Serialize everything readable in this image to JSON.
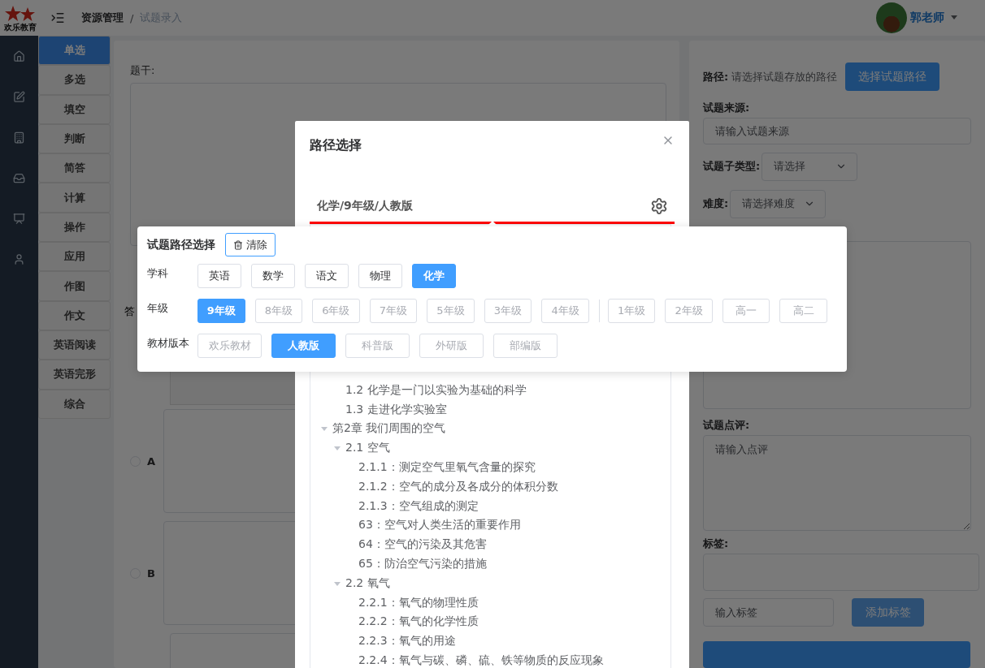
{
  "header": {
    "logo_text": "欢乐教育",
    "breadcrumb_separator": "/",
    "breadcrumb": [
      {
        "label": "资源管理",
        "current": false
      },
      {
        "label": "试题录入",
        "current": true
      }
    ],
    "user": "郭老师"
  },
  "question_types": [
    {
      "label": "单选",
      "selected": true
    },
    {
      "label": "多选",
      "selected": false
    },
    {
      "label": "填空",
      "selected": false
    },
    {
      "label": "判断",
      "selected": false
    },
    {
      "label": "简答",
      "selected": false
    },
    {
      "label": "计算",
      "selected": false
    },
    {
      "label": "操作",
      "selected": false
    },
    {
      "label": "应用",
      "selected": false
    },
    {
      "label": "作图",
      "selected": false
    },
    {
      "label": "作文",
      "selected": false
    },
    {
      "label": "英语阅读",
      "selected": false
    },
    {
      "label": "英语完形",
      "selected": false
    },
    {
      "label": "综合",
      "selected": false
    }
  ],
  "editor": {
    "stem_label": "题干:",
    "answer_label": "答",
    "options": [
      {
        "letter": "A",
        "selected": false
      },
      {
        "letter": "B",
        "selected": false
      }
    ]
  },
  "side_form": {
    "path_label": "路径:",
    "path_hint": "请选择试题存放的路径",
    "path_button": "选择试题路径",
    "source_label": "试题来源:",
    "source_placeholder": "请输入试题来源",
    "subtype_label": "试题子类型:",
    "subtype_placeholder": "请选择",
    "difficulty_label": "难度:",
    "difficulty_placeholder": "请选择难度",
    "comment_label": "试题点评:",
    "comment_placeholder": "请输入点评",
    "tags_label": "标签:",
    "tag_placeholder": "输入标签",
    "add_tag_button": "添加标签"
  },
  "dialog": {
    "title": "路径选择",
    "path": "化学/9年级/人教版",
    "tree": [
      {
        "children": [
          {
            "label": "1.2 化学是一门以实验为基础的科学"
          },
          {
            "label": "1.3 走进化学实验室"
          }
        ]
      },
      {
        "label": "第2章 我们周围的空气",
        "expanded": true,
        "children": [
          {
            "label": "2.1 空气",
            "expanded": true,
            "children": [
              {
                "label": "2.1.1：测定空气里氧气含量的探究"
              },
              {
                "label": "2.1.2：空气的成分及各成分的体积分数"
              },
              {
                "label": "2.1.3：空气组成的测定"
              },
              {
                "label": "63：空气对人类生活的重要作用"
              },
              {
                "label": "64：空气的污染及其危害"
              },
              {
                "label": "65：防治空气污染的措施"
              }
            ]
          },
          {
            "label": "2.2 氧气",
            "expanded": true,
            "children": [
              {
                "label": "2.2.1：氧气的物理性质"
              },
              {
                "label": "2.2.2：氧气的化学性质"
              },
              {
                "label": "2.2.3：氧气的用途"
              },
              {
                "label": "2.2.4：氧气与碳、磷、硫、铁等物质的反应现象"
              }
            ]
          }
        ]
      }
    ]
  },
  "popover": {
    "title": "试题路径选择",
    "clear_button": "清除",
    "rows": [
      {
        "label": "学科",
        "kind": "subject",
        "groups": [
          [
            {
              "label": "英语",
              "selected": false,
              "disabled": false
            },
            {
              "label": "数学",
              "selected": false,
              "disabled": false
            },
            {
              "label": "语文",
              "selected": false,
              "disabled": false
            },
            {
              "label": "物理",
              "selected": false,
              "disabled": false
            },
            {
              "label": "化学",
              "selected": true,
              "disabled": false
            }
          ]
        ]
      },
      {
        "label": "年级",
        "kind": "grade",
        "groups": [
          [
            {
              "label": "9年级",
              "selected": true,
              "disabled": false
            },
            {
              "label": "8年级",
              "selected": false,
              "disabled": true
            },
            {
              "label": "6年级",
              "selected": false,
              "disabled": true
            },
            {
              "label": "7年级",
              "selected": false,
              "disabled": true
            },
            {
              "label": "5年级",
              "selected": false,
              "disabled": true
            },
            {
              "label": "3年级",
              "selected": false,
              "disabled": true
            },
            {
              "label": "4年级",
              "selected": false,
              "disabled": true
            }
          ],
          [
            {
              "label": "1年级",
              "selected": false,
              "disabled": true
            },
            {
              "label": "2年级",
              "selected": false,
              "disabled": true
            },
            {
              "label": "高一",
              "selected": false,
              "disabled": true
            },
            {
              "label": "高二",
              "selected": false,
              "disabled": true
            }
          ]
        ]
      },
      {
        "label": "教材版本",
        "kind": "textbook",
        "groups": [
          [
            {
              "label": "欢乐教材",
              "selected": false,
              "disabled": true
            },
            {
              "label": "人教版",
              "selected": true,
              "disabled": false
            },
            {
              "label": "科普版",
              "selected": false,
              "disabled": true
            },
            {
              "label": "外研版",
              "selected": false,
              "disabled": true
            },
            {
              "label": "部编版",
              "selected": false,
              "disabled": true
            }
          ]
        ]
      }
    ]
  }
}
